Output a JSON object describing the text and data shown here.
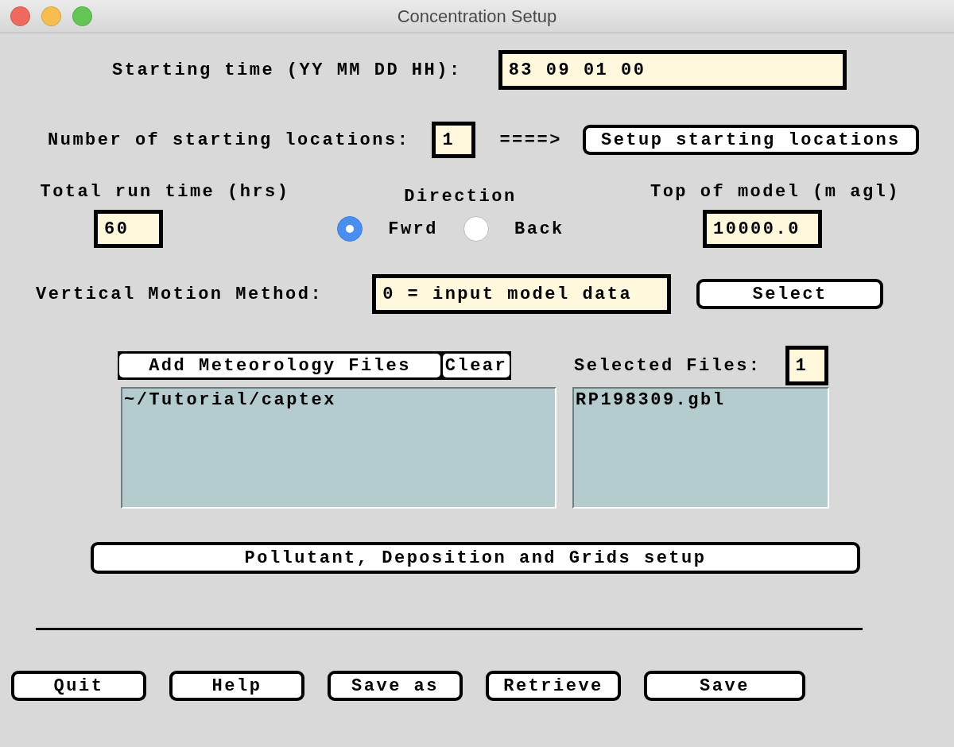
{
  "window": {
    "title": "Concentration Setup"
  },
  "starting_time": {
    "label": "Starting time (YY MM DD HH):",
    "value": "83 09 01 00"
  },
  "starting_locations": {
    "label": "Number of starting locations:",
    "value": "1",
    "arrow": "====>",
    "button": "Setup starting locations"
  },
  "run_time": {
    "label": "Total run time (hrs)",
    "value": "60"
  },
  "direction": {
    "label": "Direction",
    "options": [
      {
        "label": "Fwrd",
        "selected": true
      },
      {
        "label": "Back",
        "selected": false
      }
    ]
  },
  "top_of_model": {
    "label": "Top of model (m agl)",
    "value": "10000.0"
  },
  "vertical_motion": {
    "label": "Vertical Motion Method:",
    "value": "0 = input model data",
    "button": "Select"
  },
  "meteorology": {
    "add_button": "Add Meteorology Files",
    "clear_button": "Clear",
    "directories": [
      "~/Tutorial/captex"
    ],
    "selected_label": "Selected Files:",
    "selected_count": "1",
    "files": [
      "RP198309.gbl"
    ]
  },
  "setup_button": "Pollutant, Deposition and Grids setup",
  "buttons": [
    "Quit",
    "Help",
    "Save as",
    "Retrieve",
    "Save"
  ]
}
